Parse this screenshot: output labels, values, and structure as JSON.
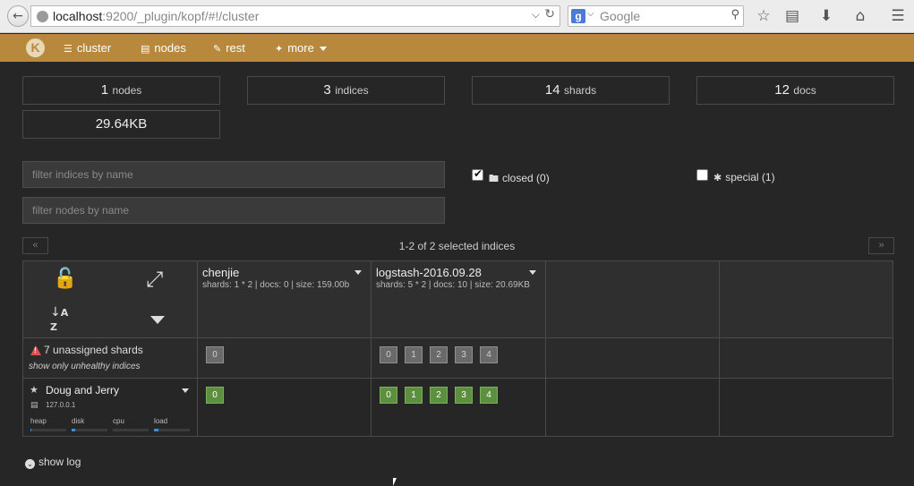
{
  "browser": {
    "url_host": "localhost",
    "url_rest": ":9200/_plugin/kopf/#!/cluster",
    "search_placeholder": "Google"
  },
  "nav": {
    "logo": "K",
    "items": [
      {
        "label": "cluster",
        "icon": "sitemap-icon"
      },
      {
        "label": "nodes",
        "icon": "server-icon"
      },
      {
        "label": "rest",
        "icon": "edit-icon"
      },
      {
        "label": "more",
        "icon": "wand-icon"
      }
    ]
  },
  "stats": {
    "nodes": {
      "value": "1",
      "label": "nodes"
    },
    "indices": {
      "value": "3",
      "label": "indices"
    },
    "shards": {
      "value": "14",
      "label": "shards"
    },
    "docs": {
      "value": "12",
      "label": "docs"
    },
    "size": "29.64KB"
  },
  "filters": {
    "indices_placeholder": "filter indices by name",
    "nodes_placeholder": "filter nodes by name",
    "closed_label": "closed (0)",
    "closed_checked": true,
    "special_label": "special (1)",
    "special_checked": false
  },
  "pager": {
    "prev": "«",
    "next": "»",
    "text": "1-2 of 2 selected indices"
  },
  "indices": [
    {
      "name": "chenjie",
      "meta": "shards: 1 * 2 | docs: 0 | size: 159.00b",
      "unassigned": [
        "0"
      ],
      "assigned": [
        "0"
      ]
    },
    {
      "name": "logstash-2016.09.28",
      "meta": "shards: 5 * 2 | docs: 10 | size: 20.69KB",
      "unassigned": [
        "0",
        "1",
        "2",
        "3",
        "4"
      ],
      "assigned": [
        "0",
        "1",
        "2",
        "3",
        "4"
      ]
    }
  ],
  "unassigned": {
    "text": "7 unassigned shards",
    "link": "show only unhealthy indices"
  },
  "node": {
    "name": "Doug and Jerry",
    "host": "127.0.0.1",
    "metrics": [
      {
        "label": "heap",
        "level": 0.02
      },
      {
        "label": "disk",
        "level": 0.1
      },
      {
        "label": "cpu",
        "level": 0.0
      },
      {
        "label": "load",
        "level": 0.12
      }
    ]
  },
  "footer": {
    "show_log": "show log"
  },
  "colors": {
    "nav_bg": "#b8883c",
    "shard_ok": "#5c8f3e",
    "shard_unassigned": "#6a6a6a",
    "warning": "#d9534f"
  }
}
